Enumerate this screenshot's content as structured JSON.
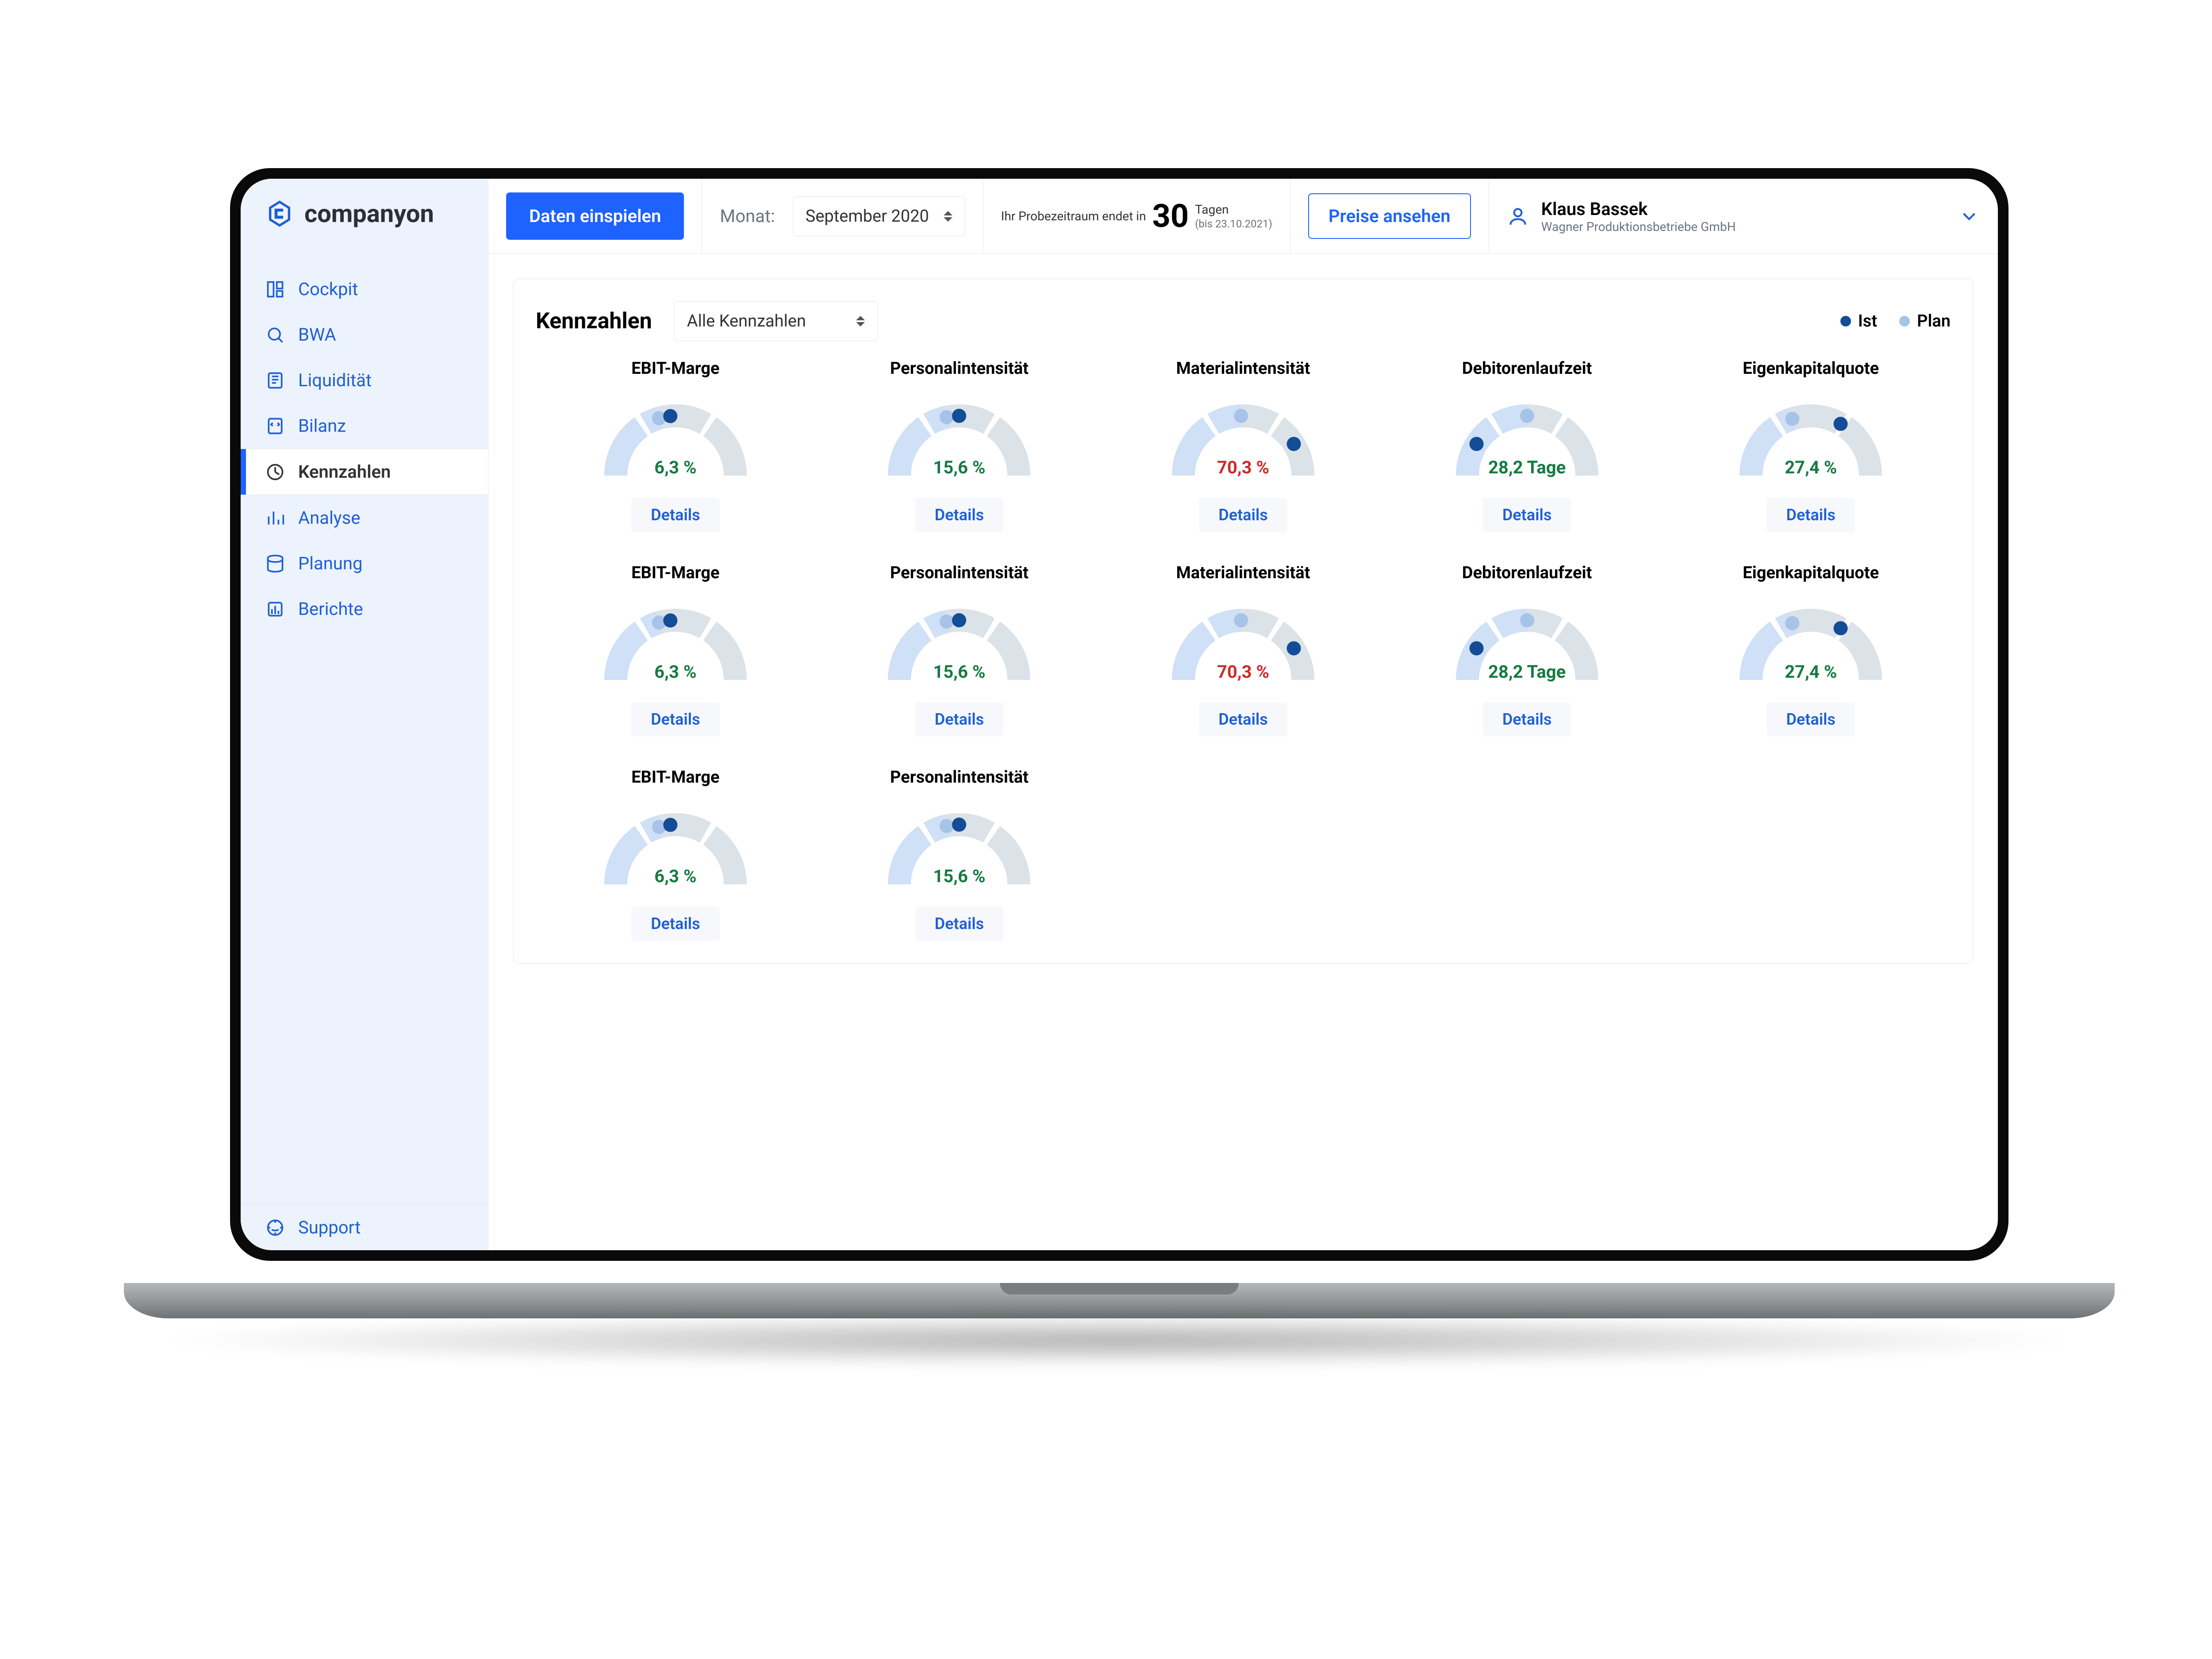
{
  "app_name": "companyon",
  "nav": {
    "items": [
      {
        "id": "cockpit",
        "label": "Cockpit"
      },
      {
        "id": "bwa",
        "label": "BWA"
      },
      {
        "id": "liquiditaet",
        "label": "Liquidität"
      },
      {
        "id": "bilanz",
        "label": "Bilanz"
      },
      {
        "id": "kennzahlen",
        "label": "Kennzahlen"
      },
      {
        "id": "analyse",
        "label": "Analyse"
      },
      {
        "id": "planung",
        "label": "Planung"
      },
      {
        "id": "berichte",
        "label": "Berichte"
      }
    ],
    "support": "Support",
    "active": "kennzahlen"
  },
  "topbar": {
    "import_btn": "Daten einspielen",
    "month_label": "Monat:",
    "month_value": "September 2020",
    "trial": {
      "line1": "Ihr Probezeitraum endet in",
      "days": "30",
      "days_label": "Tagen",
      "until": "(bis 23.10.2021)"
    },
    "pricing_btn": "Preise ansehen",
    "user": {
      "name": "Klaus Bassek",
      "org": "Wagner Produktionsbetriebe GmbH"
    }
  },
  "panel": {
    "title": "Kennzahlen",
    "filter": "Alle Kennzahlen",
    "legend": {
      "ist": "Ist",
      "plan": "Plan"
    },
    "details_label": "Details",
    "kpis": [
      {
        "title": "EBIT-Marge",
        "value": "6,3 %",
        "color": "green",
        "plan": 74,
        "ist": 85
      },
      {
        "title": "Personalintensität",
        "value": "15,6 %",
        "color": "green",
        "plan": 78,
        "ist": 90
      },
      {
        "title": "Materialintensität",
        "value": "70,3 %",
        "color": "red",
        "plan": 88,
        "ist": 148
      },
      {
        "title": "Debitorenlaufzeit",
        "value": "28,2 Tage",
        "color": "green",
        "plan": 90,
        "ist": 32
      },
      {
        "title": "Eigenkapitalquote",
        "value": "27,4 %",
        "color": "green",
        "plan": 72,
        "ist": 120
      },
      {
        "title": "EBIT-Marge",
        "value": "6,3 %",
        "color": "green",
        "plan": 74,
        "ist": 85
      },
      {
        "title": "Personalintensität",
        "value": "15,6 %",
        "color": "green",
        "plan": 78,
        "ist": 90
      },
      {
        "title": "Materialintensität",
        "value": "70,3 %",
        "color": "red",
        "plan": 88,
        "ist": 148
      },
      {
        "title": "Debitorenlaufzeit",
        "value": "28,2 Tage",
        "color": "green",
        "plan": 90,
        "ist": 32
      },
      {
        "title": "Eigenkapitalquote",
        "value": "27,4 %",
        "color": "green",
        "plan": 72,
        "ist": 120
      },
      {
        "title": "EBIT-Marge",
        "value": "6,3 %",
        "color": "green",
        "plan": 74,
        "ist": 85
      },
      {
        "title": "Personalintensität",
        "value": "15,6 %",
        "color": "green",
        "plan": 78,
        "ist": 90
      }
    ]
  }
}
